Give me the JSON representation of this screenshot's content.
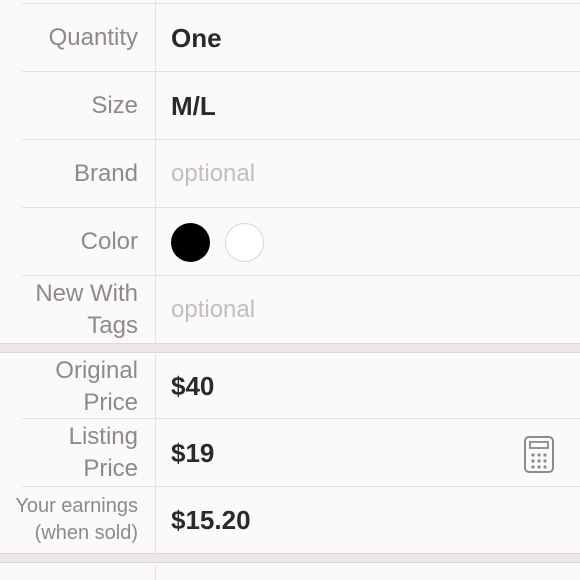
{
  "form": {
    "rows": [
      {
        "label": "Quantity",
        "value": "One"
      },
      {
        "label": "Size",
        "value": "M/L"
      },
      {
        "label": "Brand",
        "placeholder": "optional"
      },
      {
        "label": "Color",
        "colors": [
          "#000000",
          "#ffffff"
        ]
      },
      {
        "label_lines": [
          "New With",
          "Tags"
        ],
        "placeholder": "optional"
      }
    ],
    "price_rows": [
      {
        "label_lines": [
          "Original",
          "Price"
        ],
        "value": "$40"
      },
      {
        "label_lines": [
          "Listing",
          "Price"
        ],
        "value": "$19",
        "icon": "calculator-icon"
      },
      {
        "label_lines": [
          "Your earnings",
          "(when sold)"
        ],
        "value": "$15.20"
      }
    ]
  }
}
